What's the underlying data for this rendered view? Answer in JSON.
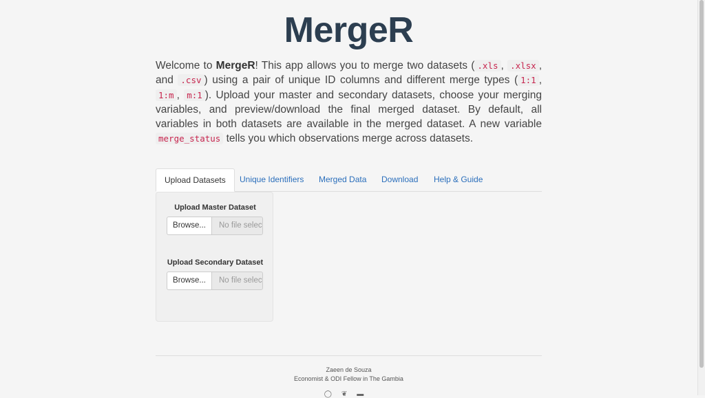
{
  "app": {
    "title": "MergeR"
  },
  "intro": {
    "welcome": "Welcome to ",
    "app_name": "MergeR",
    "text1": "! This app allows you to merge two datasets (",
    "ext_xls": ".xls",
    "sep1": ", ",
    "ext_xlsx": ".xlsx",
    "sep2": ", and ",
    "ext_csv": ".csv",
    "text2": ") using a pair of unique ID columns and different merge types (",
    "m11": "1:1",
    "sep3": ", ",
    "m1m": "1:m",
    "sep4": ", ",
    "mm1": "m:1",
    "text3": "). Upload your master and secondary datasets, choose your merging variables, and preview/download the final merged dataset. By default, all variables in both datasets are available in the merged dataset. A new variable ",
    "var": "merge_status",
    "text4": " tells you which observations merge across datasets."
  },
  "tabs": [
    {
      "label": "Upload Datasets"
    },
    {
      "label": "Unique Identifiers"
    },
    {
      "label": "Merged Data"
    },
    {
      "label": "Download"
    },
    {
      "label": "Help & Guide"
    }
  ],
  "upload": {
    "master_label": "Upload Master Dataset",
    "secondary_label": "Upload Secondary Dataset",
    "browse_label": "Browse...",
    "no_file": "No file selected"
  },
  "footer": {
    "name": "Zaeen de Souza",
    "role": "Economist & ODI Fellow in The Gambia",
    "icons": [
      "github-icon",
      "twitter-icon",
      "linkedin-icon"
    ]
  },
  "colors": {
    "title": "#2c3e50",
    "link": "#2a6ebb",
    "code": "#c7254e"
  }
}
